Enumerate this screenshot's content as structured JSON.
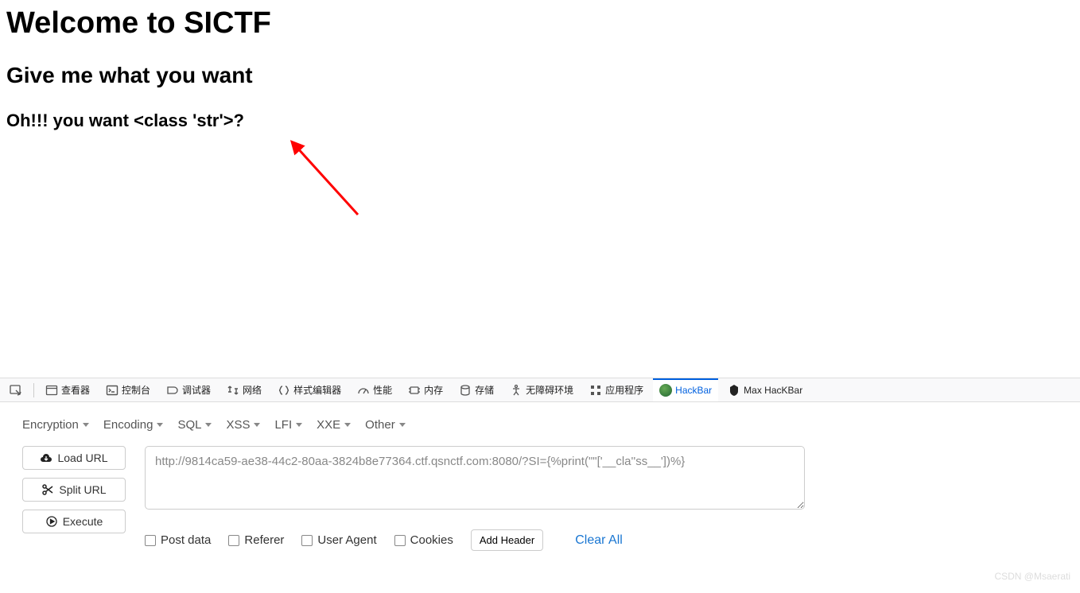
{
  "page": {
    "h1": "Welcome to SICTF",
    "h2": "Give me what you want",
    "h3": "Oh!!! you want <class 'str'>?"
  },
  "devtools": {
    "tabs": {
      "inspector": "查看器",
      "console": "控制台",
      "debugger": "调试器",
      "network": "网络",
      "style_editor": "样式编辑器",
      "performance": "性能",
      "memory": "内存",
      "storage": "存储",
      "accessibility": "无障碍环境",
      "application": "应用程序",
      "hackbar": "HackBar",
      "max_hackbar": "Max HacKBar"
    }
  },
  "hackbar": {
    "menus": {
      "encryption": "Encryption",
      "encoding": "Encoding",
      "sql": "SQL",
      "xss": "XSS",
      "lfi": "LFI",
      "xxe": "XXE",
      "other": "Other"
    },
    "buttons": {
      "load_url": "Load URL",
      "split_url": "Split URL",
      "execute": "Execute"
    },
    "url": "http://9814ca59-ae38-44c2-80aa-3824b8e77364.ctf.qsnctf.com:8080/?SI={%print(\"\"['__cla''ss__'])%}",
    "checks": {
      "post_data": "Post data",
      "referer": "Referer",
      "user_agent": "User Agent",
      "cookies": "Cookies"
    },
    "add_header": "Add Header",
    "clear_all": "Clear All"
  },
  "watermark": "CSDN @Msaerati"
}
